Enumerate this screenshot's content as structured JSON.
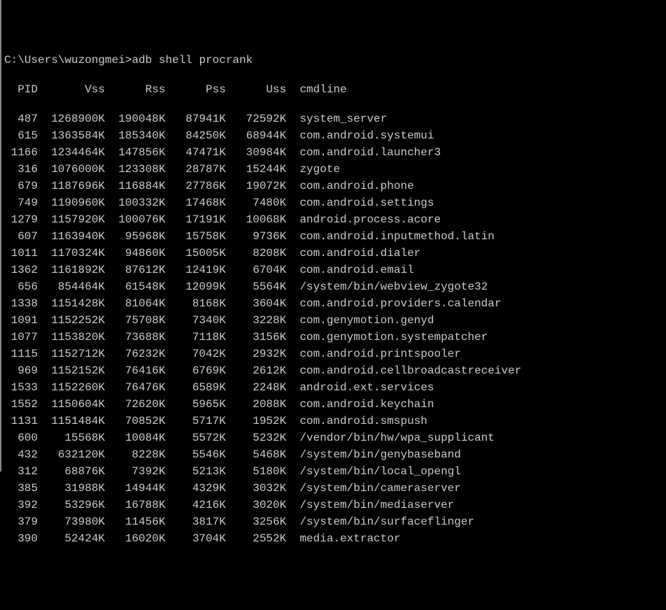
{
  "prompt": {
    "path": "C:\\Users\\wuzongmei>",
    "command": "adb shell procrank"
  },
  "headers": {
    "pid": "PID",
    "vss": "Vss",
    "rss": "Rss",
    "pss": "Pss",
    "uss": "Uss",
    "cmdline": "cmdline"
  },
  "rows": [
    {
      "pid": "487",
      "vss": "1268900K",
      "rss": "190048K",
      "pss": "87941K",
      "uss": "72592K",
      "cmd": "system_server"
    },
    {
      "pid": "615",
      "vss": "1363584K",
      "rss": "185340K",
      "pss": "84250K",
      "uss": "68944K",
      "cmd": "com.android.systemui"
    },
    {
      "pid": "1166",
      "vss": "1234464K",
      "rss": "147856K",
      "pss": "47471K",
      "uss": "30984K",
      "cmd": "com.android.launcher3"
    },
    {
      "pid": "316",
      "vss": "1076000K",
      "rss": "123308K",
      "pss": "28787K",
      "uss": "15244K",
      "cmd": "zygote"
    },
    {
      "pid": "679",
      "vss": "1187696K",
      "rss": "116884K",
      "pss": "27786K",
      "uss": "19072K",
      "cmd": "com.android.phone"
    },
    {
      "pid": "749",
      "vss": "1190960K",
      "rss": "100332K",
      "pss": "17468K",
      "uss": "7480K",
      "cmd": "com.android.settings"
    },
    {
      "pid": "1279",
      "vss": "1157920K",
      "rss": "100076K",
      "pss": "17191K",
      "uss": "10068K",
      "cmd": "android.process.acore"
    },
    {
      "pid": "607",
      "vss": "1163940K",
      "rss": "95968K",
      "pss": "15758K",
      "uss": "9736K",
      "cmd": "com.android.inputmethod.latin"
    },
    {
      "pid": "1011",
      "vss": "1170324K",
      "rss": "94860K",
      "pss": "15005K",
      "uss": "8208K",
      "cmd": "com.android.dialer"
    },
    {
      "pid": "1362",
      "vss": "1161892K",
      "rss": "87612K",
      "pss": "12419K",
      "uss": "6704K",
      "cmd": "com.android.email"
    },
    {
      "pid": "656",
      "vss": "854464K",
      "rss": "61548K",
      "pss": "12099K",
      "uss": "5564K",
      "cmd": "/system/bin/webview_zygote32"
    },
    {
      "pid": "1338",
      "vss": "1151428K",
      "rss": "81064K",
      "pss": "8168K",
      "uss": "3604K",
      "cmd": "com.android.providers.calendar"
    },
    {
      "pid": "1091",
      "vss": "1152252K",
      "rss": "75708K",
      "pss": "7340K",
      "uss": "3228K",
      "cmd": "com.genymotion.genyd"
    },
    {
      "pid": "1077",
      "vss": "1153820K",
      "rss": "73688K",
      "pss": "7118K",
      "uss": "3156K",
      "cmd": "com.genymotion.systempatcher"
    },
    {
      "pid": "1115",
      "vss": "1152712K",
      "rss": "76232K",
      "pss": "7042K",
      "uss": "2932K",
      "cmd": "com.android.printspooler"
    },
    {
      "pid": "969",
      "vss": "1152152K",
      "rss": "76416K",
      "pss": "6769K",
      "uss": "2612K",
      "cmd": "com.android.cellbroadcastreceiver"
    },
    {
      "pid": "1533",
      "vss": "1152260K",
      "rss": "76476K",
      "pss": "6589K",
      "uss": "2248K",
      "cmd": "android.ext.services"
    },
    {
      "pid": "1552",
      "vss": "1150604K",
      "rss": "72620K",
      "pss": "5965K",
      "uss": "2088K",
      "cmd": "com.android.keychain"
    },
    {
      "pid": "1131",
      "vss": "1151484K",
      "rss": "70852K",
      "pss": "5717K",
      "uss": "1952K",
      "cmd": "com.android.smspush"
    },
    {
      "pid": "600",
      "vss": "15568K",
      "rss": "10084K",
      "pss": "5572K",
      "uss": "5232K",
      "cmd": "/vendor/bin/hw/wpa_supplicant"
    },
    {
      "pid": "432",
      "vss": "632120K",
      "rss": "8228K",
      "pss": "5546K",
      "uss": "5468K",
      "cmd": "/system/bin/genybaseband"
    },
    {
      "pid": "312",
      "vss": "68876K",
      "rss": "7392K",
      "pss": "5213K",
      "uss": "5180K",
      "cmd": "/system/bin/local_opengl"
    },
    {
      "pid": "385",
      "vss": "31988K",
      "rss": "14944K",
      "pss": "4329K",
      "uss": "3032K",
      "cmd": "/system/bin/cameraserver"
    },
    {
      "pid": "392",
      "vss": "53296K",
      "rss": "16788K",
      "pss": "4216K",
      "uss": "3020K",
      "cmd": "/system/bin/mediaserver"
    },
    {
      "pid": "379",
      "vss": "73980K",
      "rss": "11456K",
      "pss": "3817K",
      "uss": "3256K",
      "cmd": "/system/bin/surfaceflinger"
    },
    {
      "pid": "390",
      "vss": "52424K",
      "rss": "16020K",
      "pss": "3704K",
      "uss": "2552K",
      "cmd": "media.extractor"
    }
  ]
}
